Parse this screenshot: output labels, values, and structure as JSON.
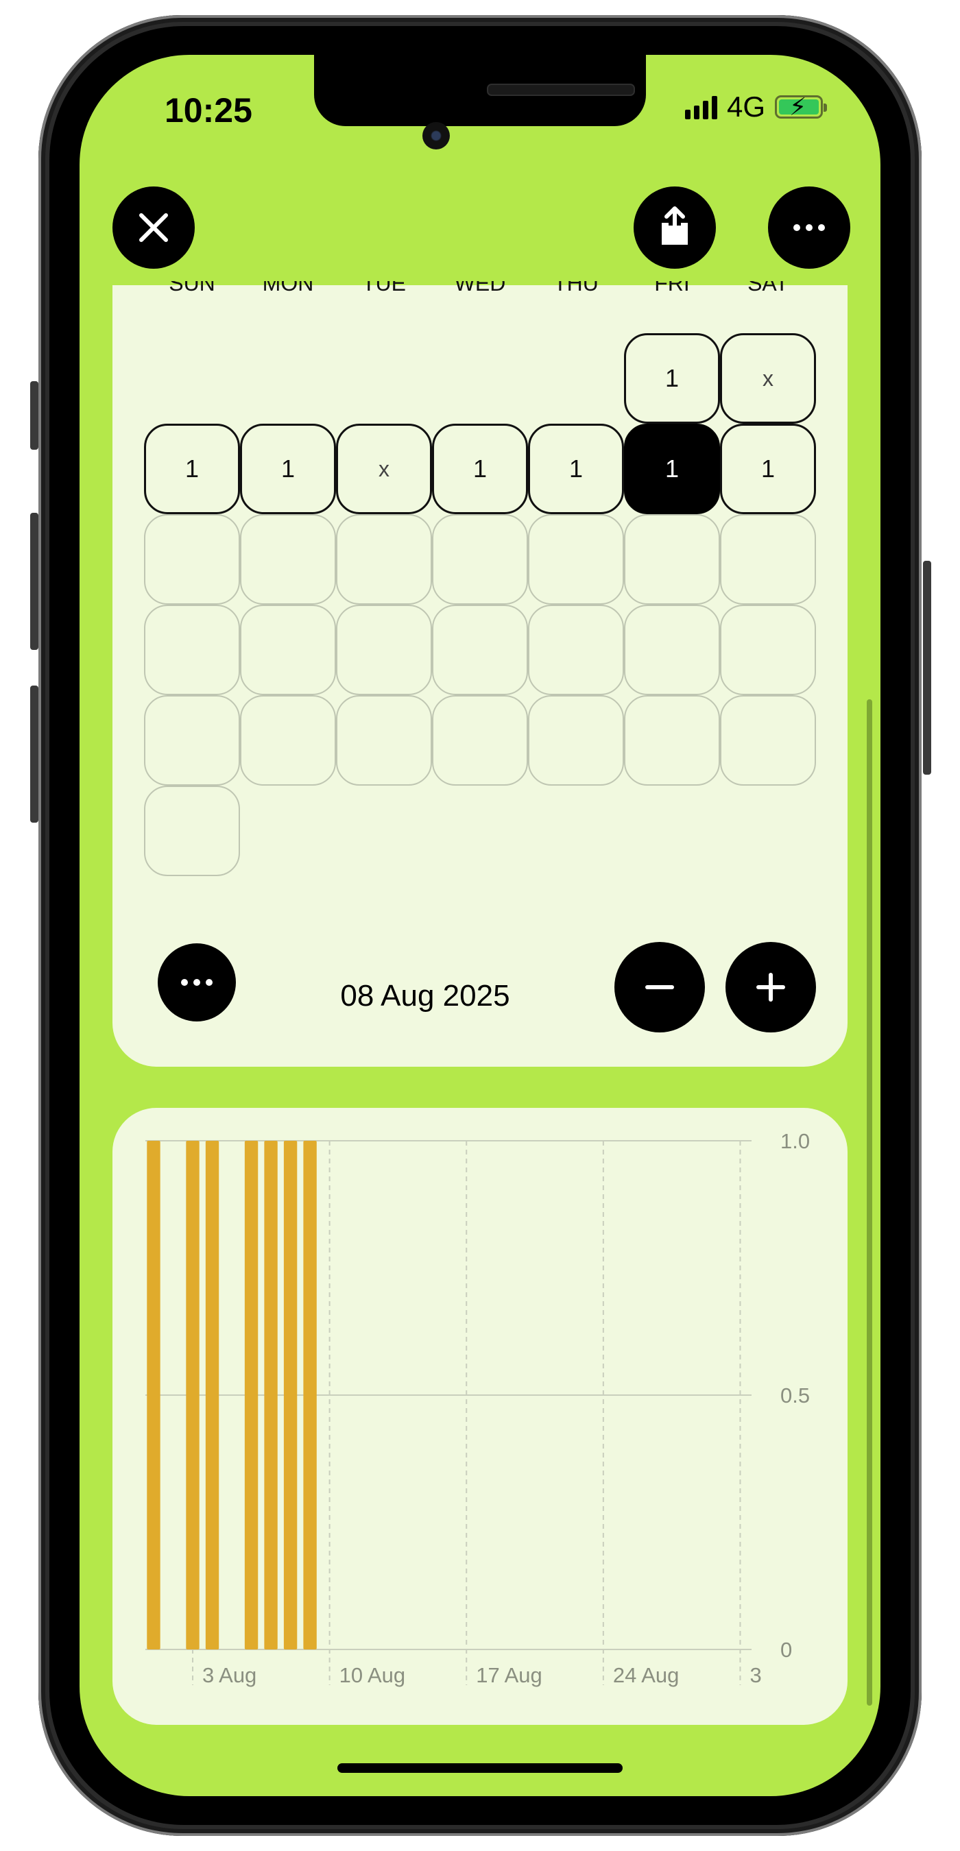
{
  "status_bar": {
    "time": "10:25",
    "network": "4G"
  },
  "toolbar": {
    "close_icon": "close-icon",
    "share_icon": "share-icon",
    "more_icon": "more-icon"
  },
  "calendar": {
    "weekdays": [
      "SUN",
      "MON",
      "TUE",
      "WED",
      "THU",
      "FRI",
      "SAT"
    ],
    "weeks": [
      [
        "",
        "",
        "",
        "",
        "",
        "1",
        "x"
      ],
      [
        "1",
        "1",
        "x",
        "1",
        "1",
        "1",
        "1"
      ],
      [
        "",
        "",
        "",
        "",
        "",
        "",
        ""
      ],
      [
        "",
        "",
        "",
        "",
        "",
        "",
        ""
      ],
      [
        "",
        "",
        "",
        "",
        "",
        "",
        ""
      ],
      [
        ""
      ]
    ],
    "selected_day": "08 Aug 2025",
    "date_label": "08 Aug 2025"
  },
  "date_controls": {
    "more_icon": "more-icon",
    "minus_icon": "minus-icon",
    "plus_icon": "plus-icon"
  },
  "chart_data": {
    "type": "bar",
    "x": [
      "2025-08-01",
      "2025-08-03",
      "2025-08-04",
      "2025-08-06",
      "2025-08-07",
      "2025-08-08",
      "2025-08-09"
    ],
    "values": [
      1,
      1,
      1,
      1,
      1,
      1,
      1
    ],
    "x_range": [
      "2025-08-01",
      "2025-08-31"
    ],
    "x_tick_labels": [
      "3 Aug",
      "10 Aug",
      "17 Aug",
      "24 Aug",
      "3"
    ],
    "y_tick_labels": [
      "0",
      "0.5",
      "1.0"
    ],
    "ylim": [
      0,
      1
    ],
    "grid": true,
    "bar_color": "#e0ab2c"
  },
  "colors": {
    "screen_background": "#b4e84a",
    "card_background": "#f1f9df",
    "bar_color": "#e0ab2c",
    "accent_black": "#000000"
  }
}
